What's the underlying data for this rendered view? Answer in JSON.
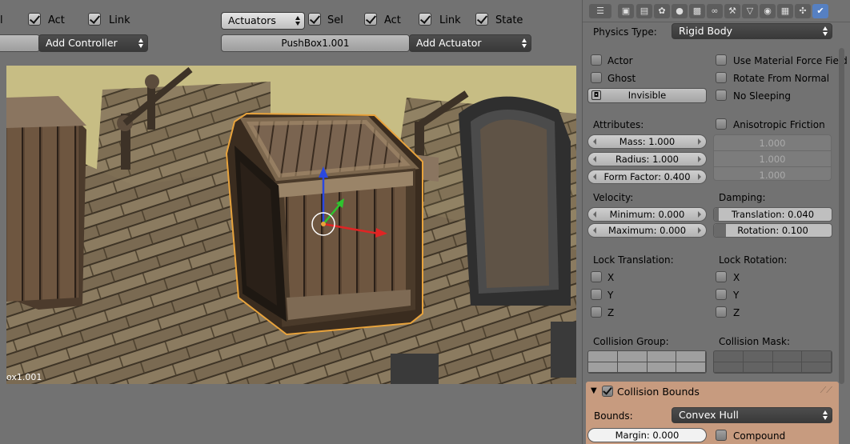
{
  "logic": {
    "controllers": {
      "act_label": "Act",
      "link_label": "Link",
      "add_controller_label": "Add Controller"
    },
    "actuators": {
      "type_select": "Actuators",
      "sel_label": "Sel",
      "act_label": "Act",
      "link_label": "Link",
      "state_label": "State",
      "object_name": "PushBox1.001",
      "add_actuator_label": "Add Actuator"
    }
  },
  "viewport": {
    "object_label": "ox1.001",
    "colors": {
      "background": "#c7bd84",
      "selection_outline": "#e8a33c",
      "axis_x": "#e02424",
      "axis_y": "#2ec42e",
      "axis_z": "#2a48e0"
    }
  },
  "properties": {
    "toolbar_icons": [
      "editor-type-icon",
      "render-icon",
      "render-layers-icon",
      "scene-icon",
      "world-icon",
      "object-icon",
      "constraints-icon",
      "modifiers-icon",
      "data-icon",
      "material-icon",
      "texture-icon",
      "particles-icon",
      "physics-icon"
    ],
    "physics_type_label": "Physics Type:",
    "physics_type_value": "Rigid Body",
    "flags": {
      "actor": "Actor",
      "ghost": "Ghost",
      "invisible": "Invisible",
      "use_material_force_field": "Use Material Force Field",
      "rotate_from_normal": "Rotate From Normal",
      "no_sleeping": "No Sleeping"
    },
    "attributes_label": "Attributes:",
    "mass": "Mass: 1.000",
    "radius": "Radius: 1.000",
    "form_factor": "Form Factor: 0.400",
    "anisotropic_friction_label": "Anisotropic Friction",
    "anisotropic_values": [
      "1.000",
      "1.000",
      "1.000"
    ],
    "velocity_label": "Velocity:",
    "velocity_min": "Minimum: 0.000",
    "velocity_max": "Maximum: 0.000",
    "damping_label": "Damping:",
    "damping_translation": "Translation: 0.040",
    "damping_translation_fraction": 0.04,
    "damping_rotation": "Rotation: 0.100",
    "damping_rotation_fraction": 0.1,
    "lock_translation_label": "Lock Translation:",
    "lock_rotation_label": "Lock Rotation:",
    "axis_labels": [
      "X",
      "Y",
      "Z"
    ],
    "collision_group_label": "Collision Group:",
    "collision_mask_label": "Collision Mask:",
    "collision_bounds_title": "Collision Bounds",
    "bounds_label": "Bounds:",
    "bounds_value": "Convex Hull",
    "margin": "Margin: 0.000",
    "compound_label": "Compound",
    "colors": {
      "active_tab": "#5680c2",
      "collision_panel": "#c79b7f"
    }
  }
}
